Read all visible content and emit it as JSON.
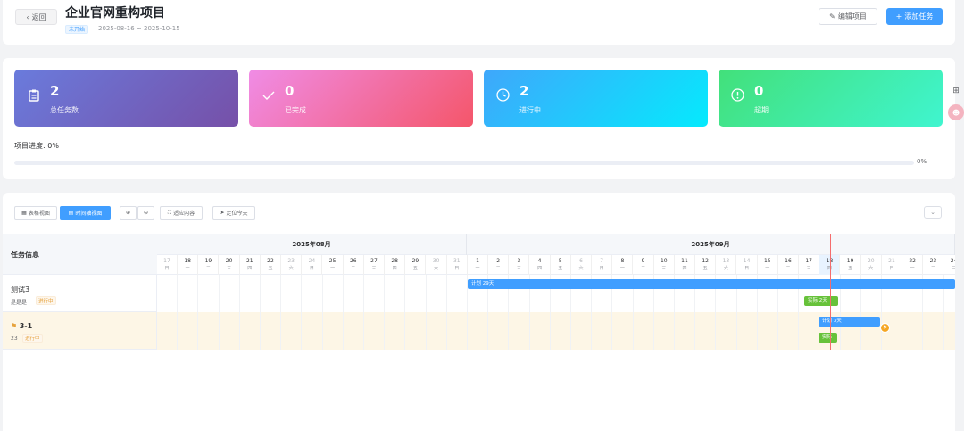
{
  "header": {
    "back_label": "返回",
    "title": "企业官网重构项目",
    "status": "未开始",
    "date_range": "2025-08-16 ~ 2025-10-15",
    "edit_label": "编辑项目",
    "add_label": "添加任务"
  },
  "stats": {
    "total": {
      "value": "2",
      "label": "总任务数",
      "icon": "clipboard-icon"
    },
    "done": {
      "value": "0",
      "label": "已完成",
      "icon": "check-icon"
    },
    "running": {
      "value": "2",
      "label": "进行中",
      "icon": "clock-icon"
    },
    "overdue": {
      "value": "0",
      "label": "超期",
      "icon": "warning-icon"
    },
    "progress_label": "项目进度: 0%",
    "progress_value": 0,
    "progress_text": "0%"
  },
  "gantt": {
    "table_view": "表格视图",
    "timeline_view": "时间轴视图",
    "fit_label": "适应内容",
    "today_label": "定位今天",
    "task_info_header": "任务信息",
    "months": [
      "2025年08月",
      "2025年09月"
    ],
    "aug_days": [
      {
        "d": "17",
        "w": "日",
        "weekend": true
      },
      {
        "d": "18",
        "w": "一"
      },
      {
        "d": "19",
        "w": "二"
      },
      {
        "d": "20",
        "w": "三"
      },
      {
        "d": "21",
        "w": "四"
      },
      {
        "d": "22",
        "w": "五"
      },
      {
        "d": "23",
        "w": "六",
        "weekend": true
      },
      {
        "d": "24",
        "w": "日",
        "weekend": true
      },
      {
        "d": "25",
        "w": "一"
      },
      {
        "d": "26",
        "w": "二"
      },
      {
        "d": "27",
        "w": "三"
      },
      {
        "d": "28",
        "w": "四"
      },
      {
        "d": "29",
        "w": "五"
      },
      {
        "d": "30",
        "w": "六",
        "weekend": true
      },
      {
        "d": "31",
        "w": "日",
        "weekend": true
      }
    ],
    "sep_days": [
      {
        "d": "1",
        "w": "一"
      },
      {
        "d": "2",
        "w": "二"
      },
      {
        "d": "3",
        "w": "三"
      },
      {
        "d": "4",
        "w": "四"
      },
      {
        "d": "5",
        "w": "五"
      },
      {
        "d": "6",
        "w": "六",
        "weekend": true
      },
      {
        "d": "7",
        "w": "日",
        "weekend": true
      },
      {
        "d": "8",
        "w": "一"
      },
      {
        "d": "9",
        "w": "二"
      },
      {
        "d": "10",
        "w": "三"
      },
      {
        "d": "11",
        "w": "四"
      },
      {
        "d": "12",
        "w": "五"
      },
      {
        "d": "13",
        "w": "六",
        "weekend": true
      },
      {
        "d": "14",
        "w": "日",
        "weekend": true
      },
      {
        "d": "15",
        "w": "一"
      },
      {
        "d": "16",
        "w": "二"
      },
      {
        "d": "17",
        "w": "三"
      },
      {
        "d": "18",
        "w": "四",
        "today": true
      },
      {
        "d": "19",
        "w": "五"
      },
      {
        "d": "20",
        "w": "六",
        "weekend": true
      },
      {
        "d": "21",
        "w": "日",
        "weekend": true
      },
      {
        "d": "22",
        "w": "一"
      },
      {
        "d": "23",
        "w": "二"
      },
      {
        "d": "24",
        "w": "三"
      }
    ],
    "tasks": [
      {
        "name": "测试3",
        "owner": "是是是",
        "status": "进行中",
        "plan_label": "计划 29天",
        "actual_label": "实际 2天"
      },
      {
        "name": "3-1",
        "owner": "23",
        "status": "进行中",
        "plan_label": "计划 3天",
        "actual_label": "实际"
      }
    ]
  }
}
